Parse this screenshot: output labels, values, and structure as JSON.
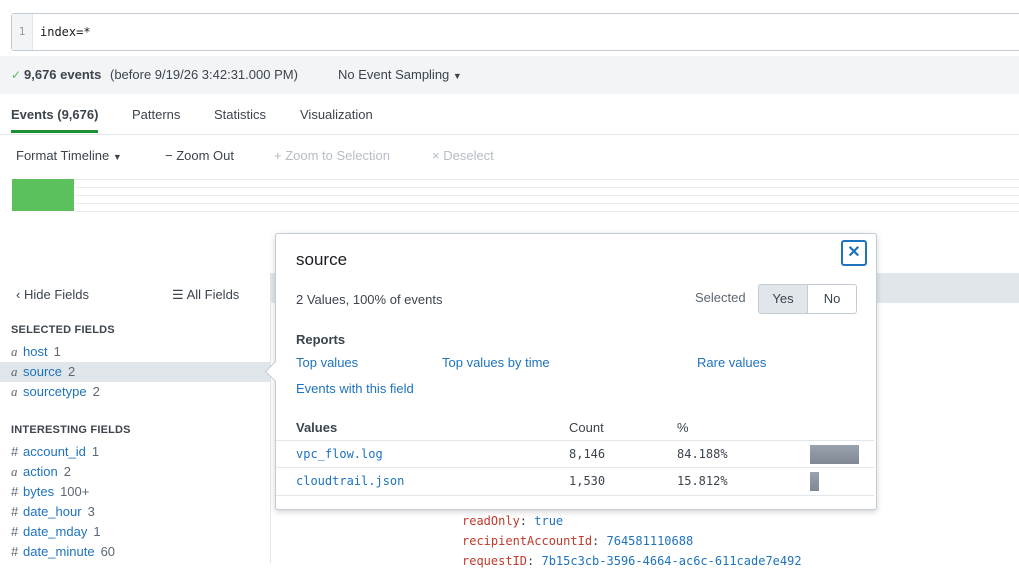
{
  "search": {
    "line_number": "1",
    "query": "index=*"
  },
  "summary": {
    "check_icon": "check-icon",
    "event_count": "9,676 events",
    "before": "(before 9/19/26 3:42:31.000 PM)",
    "sampling": "No Event Sampling"
  },
  "tabs": [
    {
      "label": "Events (9,676)",
      "active": true
    },
    {
      "label": "Patterns"
    },
    {
      "label": "Statistics"
    },
    {
      "label": "Visualization"
    }
  ],
  "toolbar": {
    "format_timeline": "Format Timeline",
    "zoom_out": "Zoom Out",
    "zoom_selection": "Zoom to Selection",
    "deselect": "Deselect"
  },
  "sidebar": {
    "hide_fields": "Hide Fields",
    "all_fields": "All Fields",
    "selected_heading": "SELECTED FIELDS",
    "selected": [
      {
        "type": "a",
        "name": "host",
        "count": "1"
      },
      {
        "type": "a",
        "name": "source",
        "count": "2",
        "active": true
      },
      {
        "type": "a",
        "name": "sourcetype",
        "count": "2"
      }
    ],
    "interesting_heading": "INTERESTING FIELDS",
    "interesting": [
      {
        "type": "#",
        "name": "account_id",
        "count": "1"
      },
      {
        "type": "a",
        "name": "action",
        "count": "2"
      },
      {
        "type": "#",
        "name": "bytes",
        "count": "100+"
      },
      {
        "type": "#",
        "name": "date_hour",
        "count": "3"
      },
      {
        "type": "#",
        "name": "date_mday",
        "count": "1"
      },
      {
        "type": "#",
        "name": "date_minute",
        "count": "60"
      }
    ]
  },
  "events": [
    {
      "key": "readOnly",
      "value": "true"
    },
    {
      "key": "recipientAccountId",
      "value": "764581110688"
    },
    {
      "key": "requestID",
      "value": "7b15c3cb-3596-4664-ac6c-611cade7e492"
    }
  ],
  "popover": {
    "title": "source",
    "meta": "2 Values, 100% of events",
    "selected_label": "Selected",
    "yes": "Yes",
    "no": "No",
    "reports_heading": "Reports",
    "report_links": [
      "Top values",
      "Top values by time",
      "Rare values",
      "Events with this field"
    ],
    "table_headers": {
      "values": "Values",
      "count": "Count",
      "pct": "%"
    },
    "rows": [
      {
        "value": "vpc_flow.log",
        "count": "8,146",
        "pct": "84.188%",
        "fraction": 0.84188
      },
      {
        "value": "cloudtrail.json",
        "count": "1,530",
        "pct": "15.812%",
        "fraction": 0.15812
      }
    ]
  }
}
